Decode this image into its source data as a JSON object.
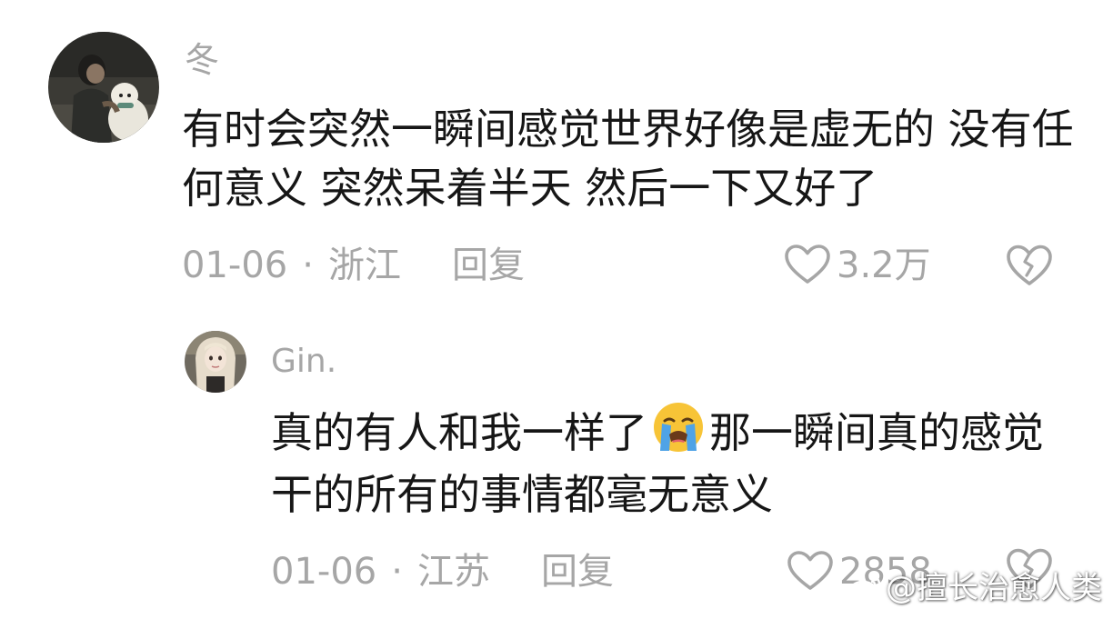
{
  "comments": [
    {
      "username": "冬",
      "text": "有时会突然一瞬间感觉世界好像是虚无的 没有任何意义 突然呆着半天 然后一下又好了",
      "date": "01-06",
      "separator": "·",
      "location": "浙江",
      "reply_label": "回复",
      "like_count": "3.2万",
      "like_icon": "heart-outline-icon",
      "dislike_icon": "broken-heart-icon"
    },
    {
      "username": "Gin.",
      "text_before_emoji": "真的有人和我一样了",
      "emoji": "loudly-crying-face-emoji",
      "text_after_emoji": "那一瞬间真的感觉干的所有的事情都毫无意义",
      "date": "01-06",
      "separator": "·",
      "location": "江苏",
      "reply_label": "回复",
      "like_count": "2858",
      "like_icon": "heart-outline-icon",
      "dislike_icon": "broken-heart-icon"
    }
  ],
  "watermark": {
    "text": "@擅长治愈人类",
    "icon": "weibo-icon"
  },
  "colors": {
    "text_primary": "#161616",
    "text_secondary": "#a6a6a6",
    "background": "#ffffff"
  }
}
